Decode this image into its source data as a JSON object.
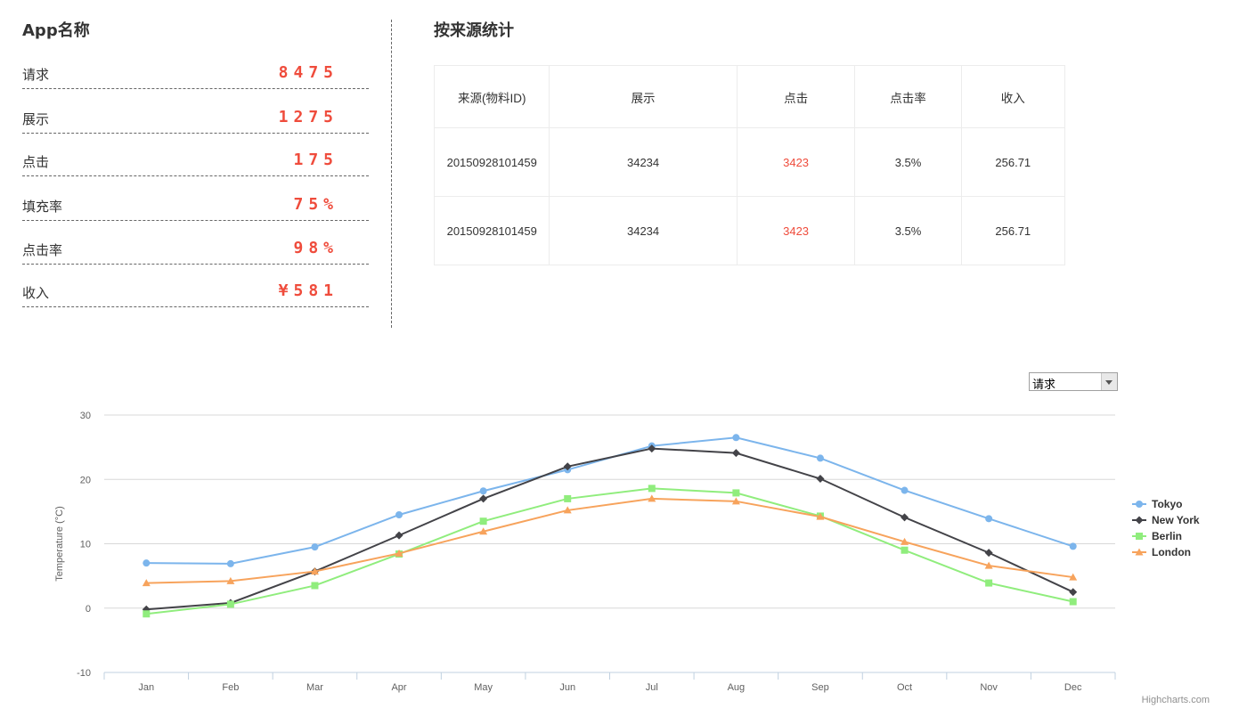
{
  "left": {
    "title": "App名称",
    "stats": [
      {
        "label": "请求",
        "value": "8475"
      },
      {
        "label": "展示",
        "value": "1275"
      },
      {
        "label": "点击",
        "value": "175"
      },
      {
        "label": "填充率",
        "value": "75%"
      },
      {
        "label": "点击率",
        "value": "98%"
      },
      {
        "label": "收入",
        "value": "¥581"
      }
    ]
  },
  "table": {
    "title": "按来源统计",
    "headers": [
      "来源(物料ID)",
      "展示",
      "点击",
      "点击率",
      "收入"
    ],
    "rows": [
      [
        "20150928101459",
        "34234",
        "3423",
        "3.5%",
        "256.71"
      ],
      [
        "20150928101459",
        "34234",
        "3423",
        "3.5%",
        "256.71"
      ]
    ]
  },
  "select": {
    "value": "请求"
  },
  "credit": "Highcharts.com",
  "chart_data": {
    "type": "line",
    "title": "",
    "xlabel": "",
    "ylabel": "Temperature (°C)",
    "ylim": [
      -10,
      30
    ],
    "yticks": [
      -10,
      0,
      10,
      20,
      30
    ],
    "grid": true,
    "legend": "right",
    "categories": [
      "Jan",
      "Feb",
      "Mar",
      "Apr",
      "May",
      "Jun",
      "Jul",
      "Aug",
      "Sep",
      "Oct",
      "Nov",
      "Dec"
    ],
    "series": [
      {
        "name": "Tokyo",
        "color": "#7cb5ec",
        "marker": "circle",
        "values": [
          7.0,
          6.9,
          9.5,
          14.5,
          18.2,
          21.5,
          25.2,
          26.5,
          23.3,
          18.3,
          13.9,
          9.6
        ]
      },
      {
        "name": "New York",
        "color": "#434348",
        "marker": "diamond",
        "values": [
          -0.2,
          0.8,
          5.7,
          11.3,
          17.0,
          22.0,
          24.8,
          24.1,
          20.1,
          14.1,
          8.6,
          2.5
        ]
      },
      {
        "name": "Berlin",
        "color": "#90ed7d",
        "marker": "square",
        "values": [
          -0.9,
          0.6,
          3.5,
          8.4,
          13.5,
          17.0,
          18.6,
          17.9,
          14.3,
          9.0,
          3.9,
          1.0
        ]
      },
      {
        "name": "London",
        "color": "#f7a35c",
        "marker": "triangle",
        "values": [
          3.9,
          4.2,
          5.7,
          8.5,
          11.9,
          15.2,
          17.0,
          16.6,
          14.2,
          10.3,
          6.6,
          4.8
        ]
      }
    ]
  }
}
